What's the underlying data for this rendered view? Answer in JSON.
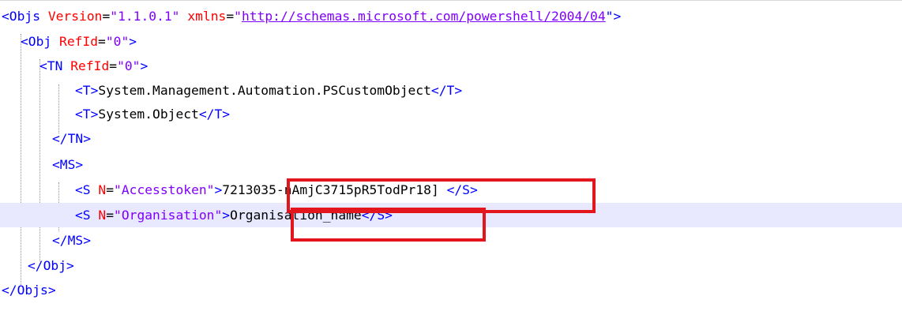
{
  "xml": {
    "objs_open": {
      "open": "<Objs",
      "version_attr": "Version",
      "version_val": "\"1.1.0.1\"",
      "xmlns_attr": "xmlns",
      "xmlns_quote": "\"",
      "xmlns_url": "http://schemas.microsoft.com/powershell/2004/04",
      "close": "\">"
    },
    "obj_open": {
      "open": "<Obj",
      "attr": "RefId",
      "val": "\"0\"",
      "close": ">"
    },
    "tn_open": {
      "open": "<TN",
      "attr": "RefId",
      "val": "\"0\"",
      "close": ">"
    },
    "t1": {
      "open": "<T>",
      "text": "System.Management.Automation.PSCustomObject",
      "close": "</T>"
    },
    "t2": {
      "open": "<T>",
      "text": "System.Object",
      "close": "</T>"
    },
    "tn_close": "</TN>",
    "ms_open": "<MS>",
    "s1": {
      "open": "<S",
      "attr": "N",
      "val": "\"Accesstoken\"",
      "gt": ">",
      "text": "7213035-nAmjC3715pR5TodPr18]",
      "close": "</S>"
    },
    "s2": {
      "open": "<S",
      "attr": "N",
      "val": "\"Organisation\"",
      "gt": ">",
      "text": "Organisation_name",
      "close": "</S>"
    },
    "ms_close": "</MS>",
    "obj_close": "</Obj>",
    "objs_close": "</Objs>"
  },
  "colors": {
    "tag": "#0000ff",
    "attribute": "#ff0000",
    "value": "#8000ff",
    "highlight_line": "#e8e8ff",
    "annotation_box": "#e3161e"
  }
}
